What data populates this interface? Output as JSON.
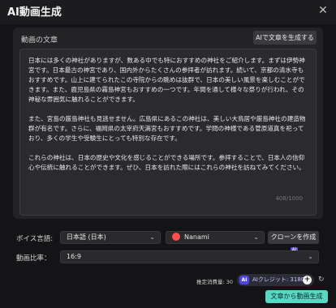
{
  "window": {
    "title": "AI動画生成",
    "close_glyph": "✕"
  },
  "script_panel": {
    "label": "動画の文章",
    "generate_button": "AIで文章を生成する",
    "paragraphs": [
      "日本には多くの神社がありますが、数ある中でも特におすすめの神社をご紹介します。まずは伊勢神宮です。日本最古の神宮であり、国内外からたくさんの参拝者が訪れます。続いて、京都の清水寺もおすすめです。山上に建てられたこの寺院からの眺めは抜群で、日本の美しい風景を楽しむことができます。また、鹿児島県の霧島神宮もおすすめの一つです。年間を通して様々な祭りが行われ、その神秘な雰囲気に触れることができます。",
      "また、宮島の厳島神社も見逃せません。広島県にあるこの神社は、美しい大鳥居や厳島神社の建造物群が有名です。さらに、福岡県の太宰府天満宮もおすすめです。学問の神様である菅原道真を祀っており、多くの学生や受験生にとっても特別な存在です。",
      "これらの神社は、日本の歴史や文化を感じることができる場所です。参拝することで、日本人の信仰心や伝統に触れることができます。ぜひ、日本を訪れた際にはこれらの神社を訪ねてみてください。"
    ],
    "char_count": "408/1000"
  },
  "voice": {
    "label": "ボイス言語:",
    "language_value": "日本語 (日本)",
    "speaker_value": "Nanami",
    "clone_button": "クローンを作成",
    "clone_badge": "AI"
  },
  "ratio": {
    "label": "動画比率：",
    "value": "16:9"
  },
  "footer": {
    "cost_label": "推定消費量: 30",
    "credit_icon": "AI",
    "credit_text": "AIクレジット: 3180",
    "plus_glyph": "+",
    "refresh_glyph": "↻",
    "submit_button": "文章から動画生成"
  },
  "colors": {
    "accent": "#58d7c2",
    "credit": "#4f46e5",
    "background": "#141416"
  },
  "icons": {
    "close": "close-icon",
    "chevron": "chevron-down-icon",
    "avatar": "voice-avatar-icon",
    "plus": "plus-icon",
    "refresh": "refresh-icon"
  }
}
